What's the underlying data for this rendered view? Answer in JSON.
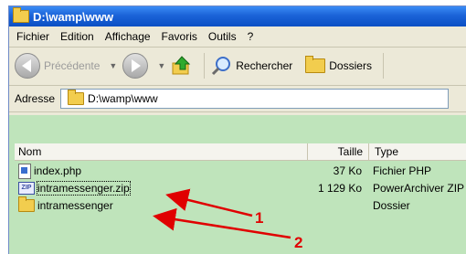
{
  "window": {
    "title": "D:\\wamp\\www"
  },
  "menu": [
    {
      "label": "Fichier"
    },
    {
      "label": "Edition"
    },
    {
      "label": "Affichage"
    },
    {
      "label": "Favoris"
    },
    {
      "label": "Outils"
    },
    {
      "label": "?"
    }
  ],
  "toolbar": {
    "back_label": "Précédente",
    "search_label": "Rechercher",
    "folders_label": "Dossiers"
  },
  "address": {
    "label": "Adresse",
    "value": "D:\\wamp\\www"
  },
  "columns": {
    "name": "Nom",
    "size": "Taille",
    "type": "Type"
  },
  "files": [
    {
      "name": "index.php",
      "size": "37 Ko",
      "type": "Fichier PHP",
      "icon": "php-file-icon"
    },
    {
      "name": "intramessenger.zip",
      "size": "1 129 Ko",
      "type": "PowerArchiver ZIP",
      "icon": "zip-file-icon"
    },
    {
      "name": "intramessenger",
      "size": "",
      "type": "Dossier",
      "icon": "folder-icon"
    }
  ],
  "annotations": [
    "1",
    "2"
  ],
  "colors": {
    "list_bg": "#bfe4bb",
    "title_bar": "#0a4fc4",
    "arrow": "#e00000"
  }
}
